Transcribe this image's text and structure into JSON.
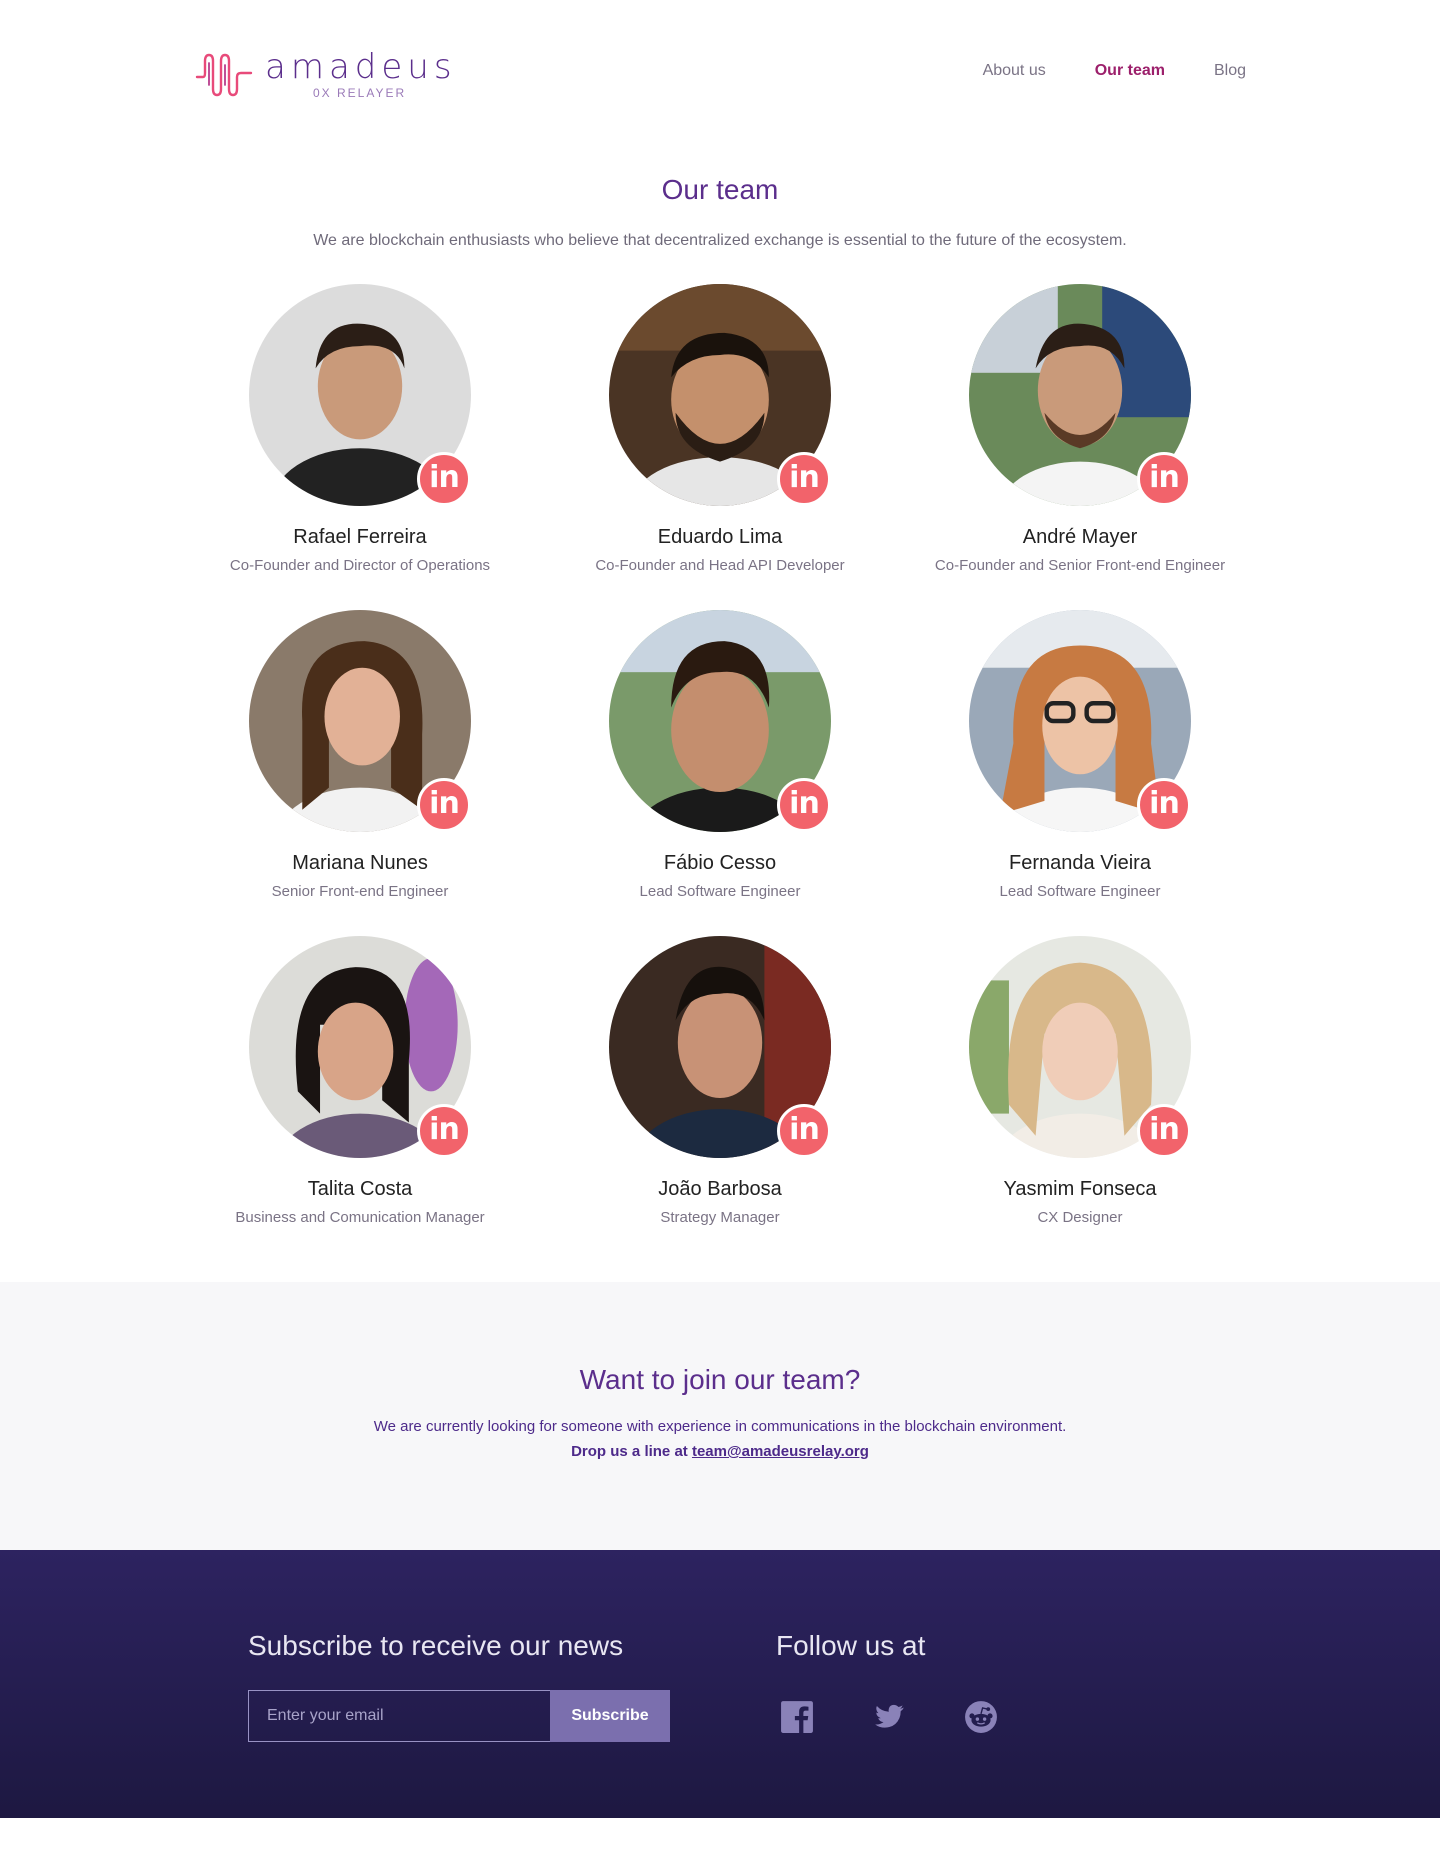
{
  "brand": {
    "name": "amadeus",
    "tagline": "0X RELAYER"
  },
  "nav": {
    "items": [
      "About us",
      "Our team",
      "Blog"
    ],
    "active": "Our team"
  },
  "team": {
    "title": "Our team",
    "intro": "We are blockchain enthusiasts who believe that decentralized exchange is essential to the future of the ecosystem.",
    "linkedin_label": "in",
    "members": [
      {
        "name": "Rafael Ferreira",
        "role": "Co-Founder and Director of Operations"
      },
      {
        "name": "Eduardo Lima",
        "role": "Co-Founder and Head API Developer"
      },
      {
        "name": "André Mayer",
        "role": "Co-Founder and Senior Front-end Engineer"
      },
      {
        "name": "Mariana Nunes",
        "role": "Senior Front-end Engineer"
      },
      {
        "name": "Fábio Cesso",
        "role": "Lead Software Engineer"
      },
      {
        "name": "Fernanda Vieira",
        "role": "Lead Software Engineer"
      },
      {
        "name": "Talita Costa",
        "role": "Business and Comunication Manager"
      },
      {
        "name": "João Barbosa",
        "role": "Strategy Manager"
      },
      {
        "name": "Yasmim Fonseca",
        "role": "CX Designer"
      }
    ]
  },
  "join": {
    "title": "Want to join our team?",
    "text": "We are currently looking for someone with experience in communications in the blockchain environment.",
    "drop_prefix": "Drop us a line at",
    "email": "team@amadeusrelay.org"
  },
  "footer": {
    "subscribe_title": "Subscribe to receive our news",
    "email_placeholder": "Enter your email",
    "subscribe_button": "Subscribe",
    "follow_title": "Follow us at",
    "socials": [
      "facebook-icon",
      "twitter-icon",
      "reddit-icon"
    ]
  },
  "colors": {
    "brand_purple": "#5b2e8c",
    "nav_active": "#9c1f6b",
    "linkedin_badge": "#f2636b",
    "footer_bg": "#2d2360",
    "subscribe_button": "#7b6fae"
  }
}
